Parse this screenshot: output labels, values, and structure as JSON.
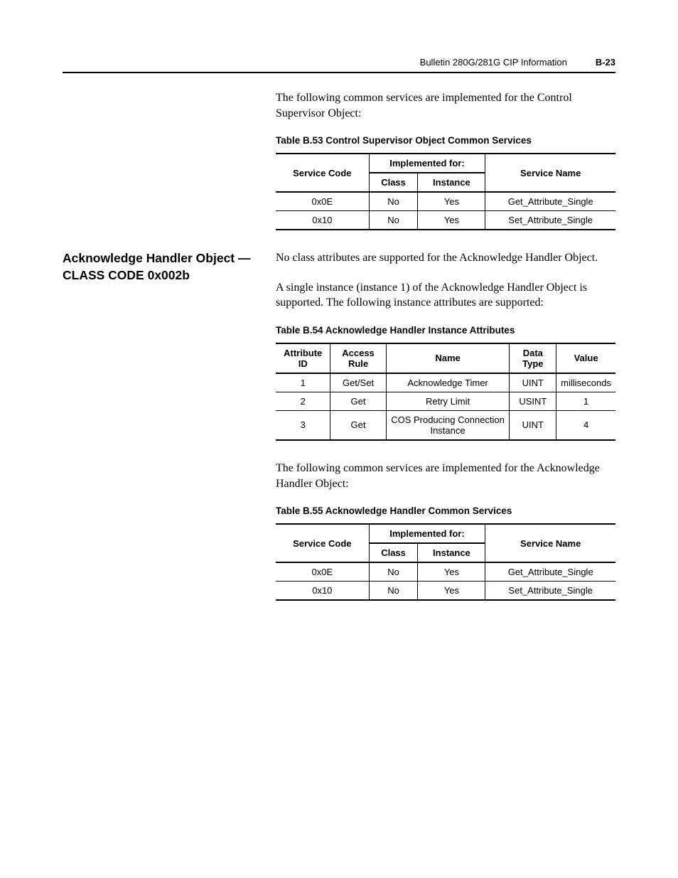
{
  "header": {
    "title": "Bulletin 280G/281G CIP Information",
    "page": "B-23"
  },
  "intro_para": "The following common services are implemented for the Control Supervisor Object:",
  "table53": {
    "caption": "Table B.53  Control Supervisor Object Common Services",
    "headers": {
      "service_code": "Service Code",
      "implemented_for": "Implemented for:",
      "class": "Class",
      "instance": "Instance",
      "service_name": "Service Name"
    },
    "rows": [
      {
        "code": "0x0E",
        "class": "No",
        "instance": "Yes",
        "name": "Get_Attribute_Single"
      },
      {
        "code": "0x10",
        "class": "No",
        "instance": "Yes",
        "name": "Set_Attribute_Single"
      }
    ]
  },
  "section": {
    "heading": "Acknowledge Handler Object — CLASS CODE 0x002b",
    "para1": "No class attributes are supported for the Acknowledge Handler Object.",
    "para2": "A single instance (instance 1) of the Acknowledge Handler Object is supported. The following instance attributes are supported:"
  },
  "table54": {
    "caption": "Table B.54  Acknowledge Handler Instance Attributes",
    "headers": {
      "attr_id": "Attribute ID",
      "access": "Access Rule",
      "name": "Name",
      "dtype": "Data Type",
      "value": "Value"
    },
    "rows": [
      {
        "id": "1",
        "access": "Get/Set",
        "name": "Acknowledge Timer",
        "dtype": "UINT",
        "value": "milliseconds"
      },
      {
        "id": "2",
        "access": "Get",
        "name": "Retry Limit",
        "dtype": "USINT",
        "value": "1"
      },
      {
        "id": "3",
        "access": "Get",
        "name": "COS Producing Connection Instance",
        "dtype": "UINT",
        "value": "4"
      }
    ]
  },
  "para3": "The following common services are implemented for the Acknowledge Handler Object:",
  "table55": {
    "caption": "Table B.55  Acknowledge Handler Common Services",
    "headers": {
      "service_code": "Service Code",
      "implemented_for": "Implemented for:",
      "class": "Class",
      "instance": "Instance",
      "service_name": "Service Name"
    },
    "rows": [
      {
        "code": "0x0E",
        "class": "No",
        "instance": "Yes",
        "name": "Get_Attribute_Single"
      },
      {
        "code": "0x10",
        "class": "No",
        "instance": "Yes",
        "name": "Set_Attribute_Single"
      }
    ]
  }
}
